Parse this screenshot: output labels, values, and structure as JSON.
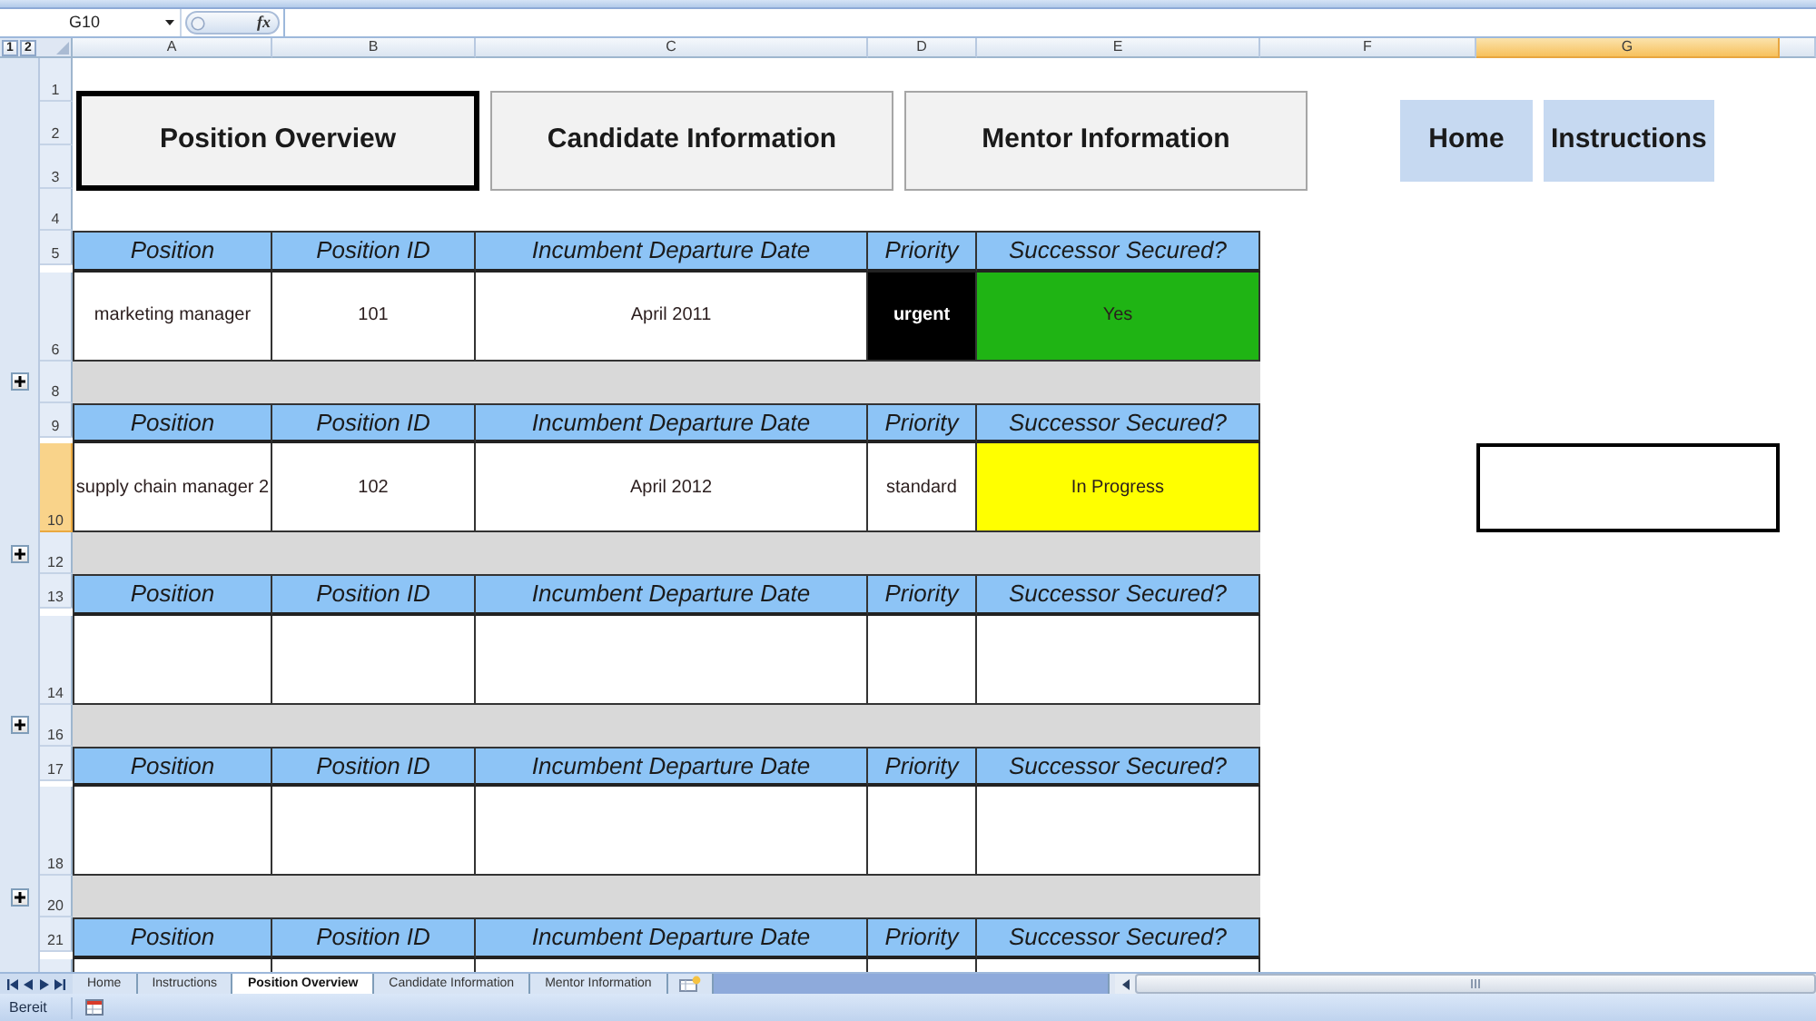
{
  "formula_bar": {
    "name_box": "G10",
    "function_label": "fx"
  },
  "outline_levels": [
    "1",
    "2"
  ],
  "columns": [
    {
      "label": "A",
      "selected": false
    },
    {
      "label": "B",
      "selected": false
    },
    {
      "label": "C",
      "selected": false
    },
    {
      "label": "D",
      "selected": false
    },
    {
      "label": "E",
      "selected": false
    },
    {
      "label": "F",
      "selected": false
    },
    {
      "label": "G",
      "selected": true
    }
  ],
  "rows": [
    {
      "label": "1",
      "selected": false
    },
    {
      "label": "2",
      "selected": false
    },
    {
      "label": "3",
      "selected": false
    },
    {
      "label": "4",
      "selected": false
    },
    {
      "label": "5",
      "selected": false
    },
    {
      "label": "6",
      "selected": false
    },
    {
      "label": "8",
      "selected": false
    },
    {
      "label": "9",
      "selected": false
    },
    {
      "label": "10",
      "selected": true
    },
    {
      "label": "12",
      "selected": false
    },
    {
      "label": "13",
      "selected": false
    },
    {
      "label": "14",
      "selected": false
    },
    {
      "label": "16",
      "selected": false
    },
    {
      "label": "17",
      "selected": false
    },
    {
      "label": "18",
      "selected": false
    },
    {
      "label": "20",
      "selected": false
    },
    {
      "label": "21",
      "selected": false
    }
  ],
  "page_buttons": [
    {
      "label": "Position Overview",
      "selected": true
    },
    {
      "label": "Candidate Information",
      "selected": false
    },
    {
      "label": "Mentor Information",
      "selected": false
    }
  ],
  "link_buttons": [
    {
      "label": "Home"
    },
    {
      "label": "Instructions"
    }
  ],
  "blocks": [
    {
      "header": [
        "Position",
        "Position ID",
        "Incumbent Departure Date",
        "Priority",
        "Successor Secured?"
      ],
      "cells": [
        {
          "text": "marketing manager"
        },
        {
          "text": "101"
        },
        {
          "text": "April 2011"
        },
        {
          "text": "urgent",
          "color": "#000000"
        },
        {
          "text": "Yes",
          "color": "#1fb414"
        }
      ]
    },
    {
      "header": [
        "Position",
        "Position ID",
        "Incumbent Departure Date",
        "Priority",
        "Successor Secured?"
      ],
      "cells": [
        {
          "text": "supply chain manager 2"
        },
        {
          "text": "102"
        },
        {
          "text": "April 2012"
        },
        {
          "text": "standard"
        },
        {
          "text": "In Progress",
          "color": "#ffff00"
        }
      ]
    },
    {
      "header": [
        "Position",
        "Position ID",
        "Incumbent Departure Date",
        "Priority",
        "Successor Secured?"
      ]
    },
    {
      "header": [
        "Position",
        "Position ID",
        "Incumbent Departure Date",
        "Priority",
        "Successor Secured?"
      ]
    },
    {
      "header": [
        "Position",
        "Position ID",
        "Incumbent Departure Date",
        "Priority",
        "Successor Secured?"
      ]
    }
  ],
  "separators": [
    {
      "expanded": false
    },
    {
      "expanded": false
    },
    {
      "expanded": false
    },
    {
      "expanded": false
    }
  ],
  "sheet_tabs": [
    {
      "label": "Home",
      "selected": false
    },
    {
      "label": "Instructions",
      "selected": false
    },
    {
      "label": "Position Overview",
      "selected": true
    },
    {
      "label": "Candidate Information",
      "selected": false
    },
    {
      "label": "Mentor Information",
      "selected": false
    }
  ],
  "status_bar": {
    "text": "Bereit"
  }
}
